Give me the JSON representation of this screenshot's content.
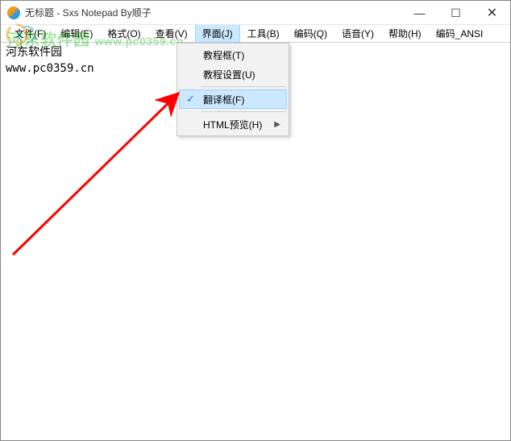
{
  "title": "无标题 - Sxs Notepad  By顺子",
  "wincontrols": {
    "min": "—",
    "max": "☐",
    "close": "✕"
  },
  "menubar": {
    "items": [
      {
        "label": "文件(F)"
      },
      {
        "label": "编辑(E)"
      },
      {
        "label": "格式(O)"
      },
      {
        "label": "查看(V)"
      },
      {
        "label": "界面(J)",
        "active": true
      },
      {
        "label": "工具(B)"
      },
      {
        "label": "编码(Q)"
      },
      {
        "label": "语音(Y)"
      },
      {
        "label": "帮助(H)"
      },
      {
        "label": "编码_ANSI"
      }
    ]
  },
  "dropdown": {
    "items": [
      {
        "label": "教程框(T)"
      },
      {
        "label": "教程设置(U)"
      },
      {
        "sep": true
      },
      {
        "label": "翻译框(F)",
        "checked": true,
        "highlighted": true
      },
      {
        "sep": true
      },
      {
        "label": "HTML预览(H)",
        "submenu": true
      }
    ]
  },
  "editor": {
    "lines": [
      "河东软件园",
      "www.pc0359.cn"
    ]
  },
  "watermark": {
    "text1": "河东软件园",
    "text2": "www.pc0359.cn"
  }
}
